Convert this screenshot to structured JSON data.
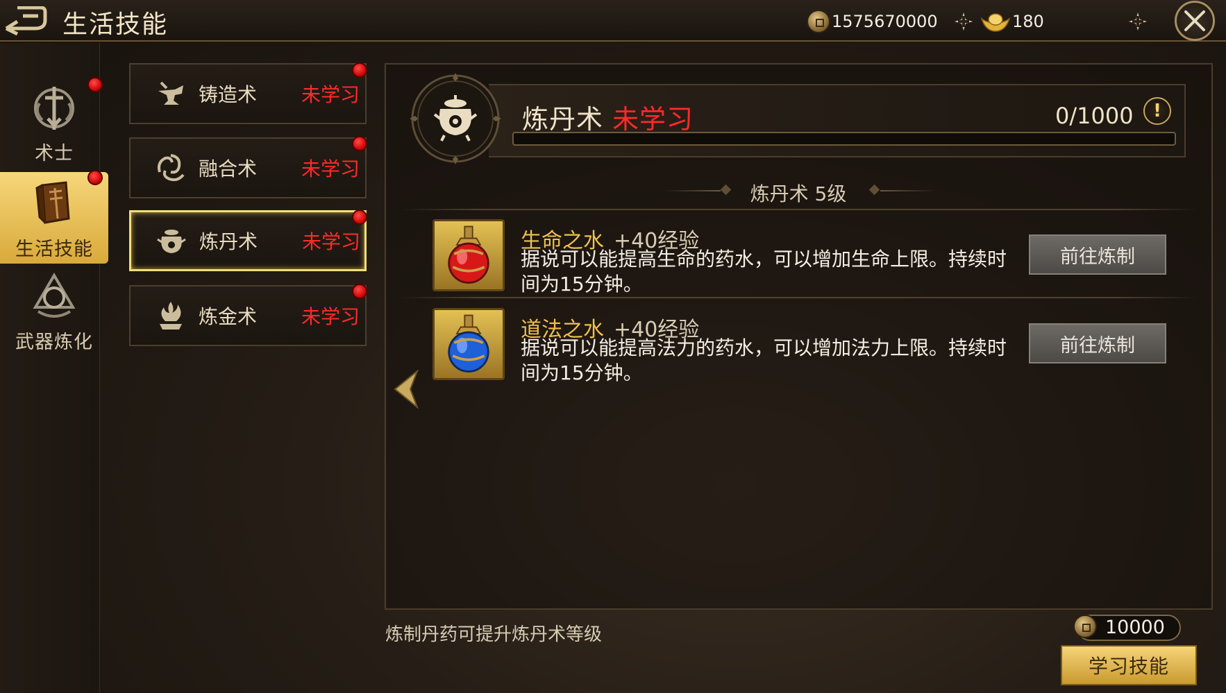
{
  "header": {
    "title": "生活技能",
    "gold": "1575670000",
    "ingot": "180"
  },
  "rail": {
    "items": [
      {
        "label": "术士",
        "icon": "warlock-emblem-icon"
      },
      {
        "label": "生活技能",
        "icon": "book-icon"
      },
      {
        "label": "武器炼化",
        "icon": "weapon-refine-emblem-icon"
      }
    ]
  },
  "skills": {
    "items": [
      {
        "name": "铸造术",
        "status": "未学习",
        "icon": "anvil-icon"
      },
      {
        "name": "融合术",
        "status": "未学习",
        "icon": "swirl-icon"
      },
      {
        "name": "炼丹术",
        "status": "未学习",
        "icon": "cauldron-icon"
      },
      {
        "name": "炼金术",
        "status": "未学习",
        "icon": "alchemy-fire-icon"
      }
    ]
  },
  "detail": {
    "skill_name": "炼丹术",
    "status": "未学习",
    "progress_text": "0/1000",
    "progress_value": 0,
    "level_title": "炼丹术 5级",
    "recipes": [
      {
        "name": "生命之水",
        "exp": "+40经验",
        "desc": "据说可以能提高生命的药水，可以增加生命上限。持续时间为15分钟。",
        "button": "前往炼制",
        "icon": "red-potion-icon",
        "potion_color": "#d81818"
      },
      {
        "name": "道法之水",
        "exp": "+40经验",
        "desc": "据说可以能提高法力的药水，可以增加法力上限。持续时间为15分钟。",
        "button": "前往炼制",
        "icon": "blue-potion-icon",
        "potion_color": "#1f5fd8"
      }
    ]
  },
  "footer": {
    "hint": "炼制丹药可提升炼丹术等级",
    "cost": "10000",
    "learn_button": "学习技能"
  },
  "colors": {
    "accent_gold": "#f1de7a",
    "status_red": "#ff2a2a",
    "recipe_name": "#efc24d"
  }
}
